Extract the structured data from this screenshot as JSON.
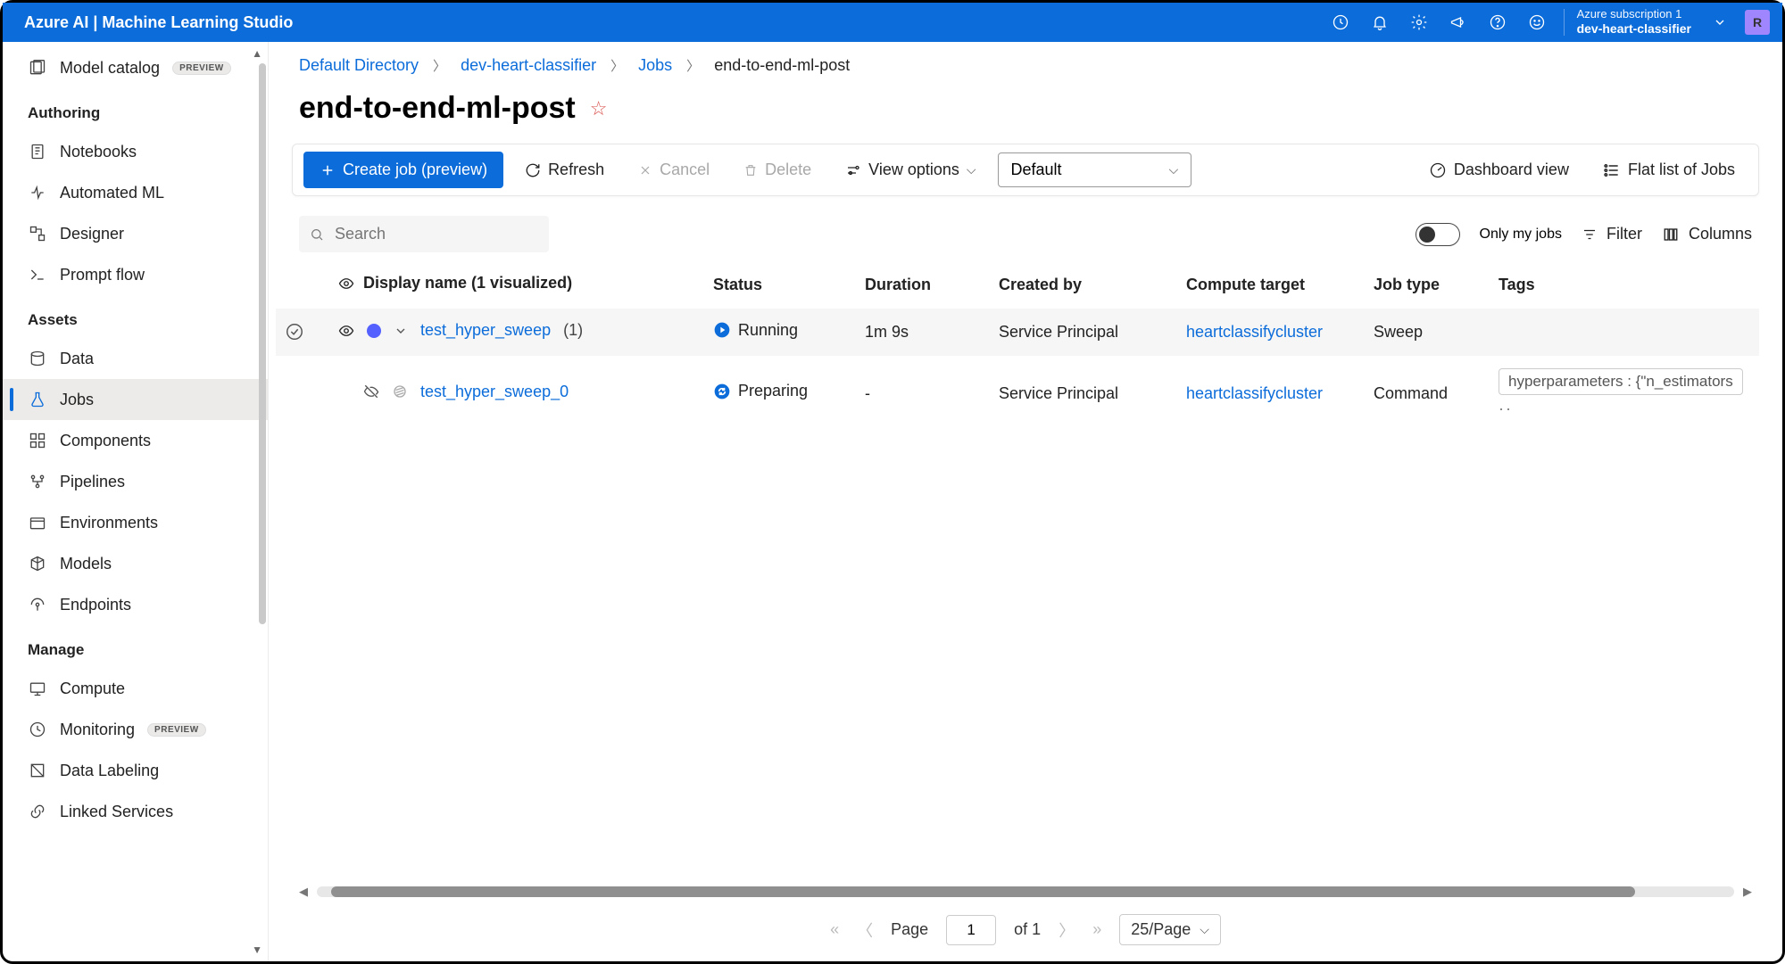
{
  "header": {
    "title": "Azure AI | Machine Learning Studio",
    "subscription": "Azure subscription 1",
    "workspace": "dev-heart-classifier",
    "avatar": "R"
  },
  "sidebar": {
    "preview_badge": "PREVIEW",
    "top_item": {
      "label": "Model catalog",
      "preview": true
    },
    "sections": [
      {
        "title": "Authoring",
        "items": [
          {
            "label": "Notebooks",
            "icon": "notebook"
          },
          {
            "label": "Automated ML",
            "icon": "automl"
          },
          {
            "label": "Designer",
            "icon": "designer"
          },
          {
            "label": "Prompt flow",
            "icon": "prompt"
          }
        ]
      },
      {
        "title": "Assets",
        "items": [
          {
            "label": "Data",
            "icon": "data"
          },
          {
            "label": "Jobs",
            "icon": "flask",
            "active": true
          },
          {
            "label": "Components",
            "icon": "components"
          },
          {
            "label": "Pipelines",
            "icon": "pipelines"
          },
          {
            "label": "Environments",
            "icon": "env"
          },
          {
            "label": "Models",
            "icon": "models"
          },
          {
            "label": "Endpoints",
            "icon": "endpoints"
          }
        ]
      },
      {
        "title": "Manage",
        "items": [
          {
            "label": "Compute",
            "icon": "compute"
          },
          {
            "label": "Monitoring",
            "icon": "monitor",
            "preview": true
          },
          {
            "label": "Data Labeling",
            "icon": "labeling"
          },
          {
            "label": "Linked Services",
            "icon": "linked"
          }
        ]
      }
    ]
  },
  "breadcrumbs": [
    {
      "label": "Default Directory",
      "link": true
    },
    {
      "label": "dev-heart-classifier",
      "link": true
    },
    {
      "label": "Jobs",
      "link": true
    },
    {
      "label": "end-to-end-ml-post",
      "link": false
    }
  ],
  "page": {
    "title": "end-to-end-ml-post"
  },
  "toolbar": {
    "create": "Create job (preview)",
    "refresh": "Refresh",
    "cancel": "Cancel",
    "delete": "Delete",
    "view_options": "View options",
    "select_value": "Default",
    "dashboard": "Dashboard view",
    "flatlist": "Flat list of Jobs"
  },
  "filters": {
    "search_placeholder": "Search",
    "only_my_jobs": "Only my jobs",
    "filter": "Filter",
    "columns": "Columns"
  },
  "table": {
    "columns": [
      "Display name (1 visualized)",
      "Status",
      "Duration",
      "Created by",
      "Compute target",
      "Job type",
      "Tags"
    ],
    "rows": [
      {
        "name": "test_hyper_sweep",
        "suffix": "(1)",
        "status": "Running",
        "status_icon": "play",
        "duration": "1m 9s",
        "created_by": "Service Principal",
        "compute": "heartclassifycluster",
        "job_type": "Sweep",
        "tag": ""
      },
      {
        "name": "test_hyper_sweep_0",
        "suffix": "",
        "status": "Preparing",
        "status_icon": "sync",
        "duration": "-",
        "created_by": "Service Principal",
        "compute": "heartclassifycluster",
        "job_type": "Command",
        "tag": "hyperparameters : {\"n_estimators"
      }
    ]
  },
  "pager": {
    "label": "Page",
    "value": "1",
    "of": "of 1",
    "size": "25/Page"
  }
}
